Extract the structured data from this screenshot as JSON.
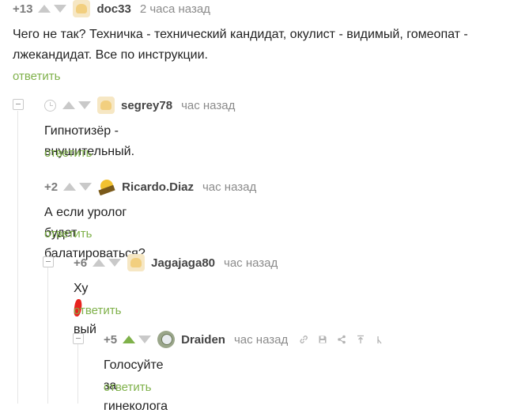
{
  "comments": [
    {
      "rating": "+13",
      "username": "doc33",
      "time": "2 часа назад",
      "text": "Чего не так? Техничка - технический кандидат, окулист - видимый, гомеопат - лжекандидат. Все по инструкции.",
      "reply_label": "ответить"
    },
    {
      "rating": "",
      "username": "segrey78",
      "time": "час назад",
      "text": "Гипнотизёр - внушительный.",
      "reply_label": "ответить"
    },
    {
      "rating": "+2",
      "username": "Ricardo.Diaz",
      "time": "час назад",
      "text": "А если уролог будет балатироваться?",
      "reply_label": "ответить"
    },
    {
      "rating": "+6",
      "username": "Jagajaga80",
      "time": "час назад",
      "text_before": "Ху",
      "text_after": "вый",
      "reply_label": "ответить"
    },
    {
      "rating": "+5",
      "username": "Draiden",
      "time": "час назад",
      "text": "Голосуйте за гинеколога",
      "reply_label": "ответить"
    }
  ],
  "icons": {
    "upvote": "arrow-up-icon",
    "downvote": "arrow-down-icon",
    "collapse": "collapse-minus-icon",
    "clock": "clock-icon",
    "link": "link-icon",
    "save": "save-icon",
    "share": "share-icon",
    "scroll_top": "scroll-top-icon",
    "more": "more-icon"
  },
  "colors": {
    "accent_green": "#7fb14a",
    "muted_gray": "#8b8b8b",
    "censor_red": "#e8231f"
  }
}
